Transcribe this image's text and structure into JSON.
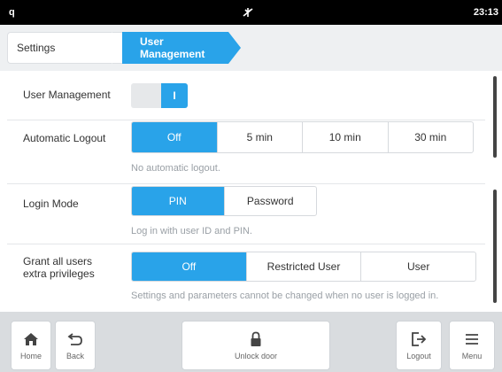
{
  "status": {
    "left_indicator": "q",
    "time": "23:13"
  },
  "breadcrumb": {
    "items": [
      "Settings",
      "User Management"
    ]
  },
  "rows": {
    "user_management": {
      "label": "User Management",
      "toggle_glyph": "I"
    },
    "auto_logout": {
      "label": "Automatic Logout",
      "options": [
        "Off",
        "5 min",
        "10 min",
        "30 min"
      ],
      "selected": "Off",
      "hint": "No automatic logout."
    },
    "login_mode": {
      "label": "Login Mode",
      "options": [
        "PIN",
        "Password"
      ],
      "selected": "PIN",
      "hint": "Log in with user ID and PIN."
    },
    "grant": {
      "label_line1": "Grant all users",
      "label_line2": "extra privileges",
      "options": [
        "Off",
        "Restricted User",
        "User"
      ],
      "selected": "Off",
      "hint": "Settings and parameters cannot be changed when no user is logged in."
    }
  },
  "toolbar": {
    "home": "Home",
    "back": "Back",
    "unlock": "Unlock door",
    "logout": "Logout",
    "menu": "Menu"
  },
  "colors": {
    "accent": "#29a3e9",
    "toolbar_bg": "#d9dcdf",
    "statusbar": "#000000"
  },
  "icons": [
    "antenna-off-icon",
    "home-icon",
    "back-icon",
    "lock-icon",
    "logout-icon",
    "menu-icon"
  ]
}
